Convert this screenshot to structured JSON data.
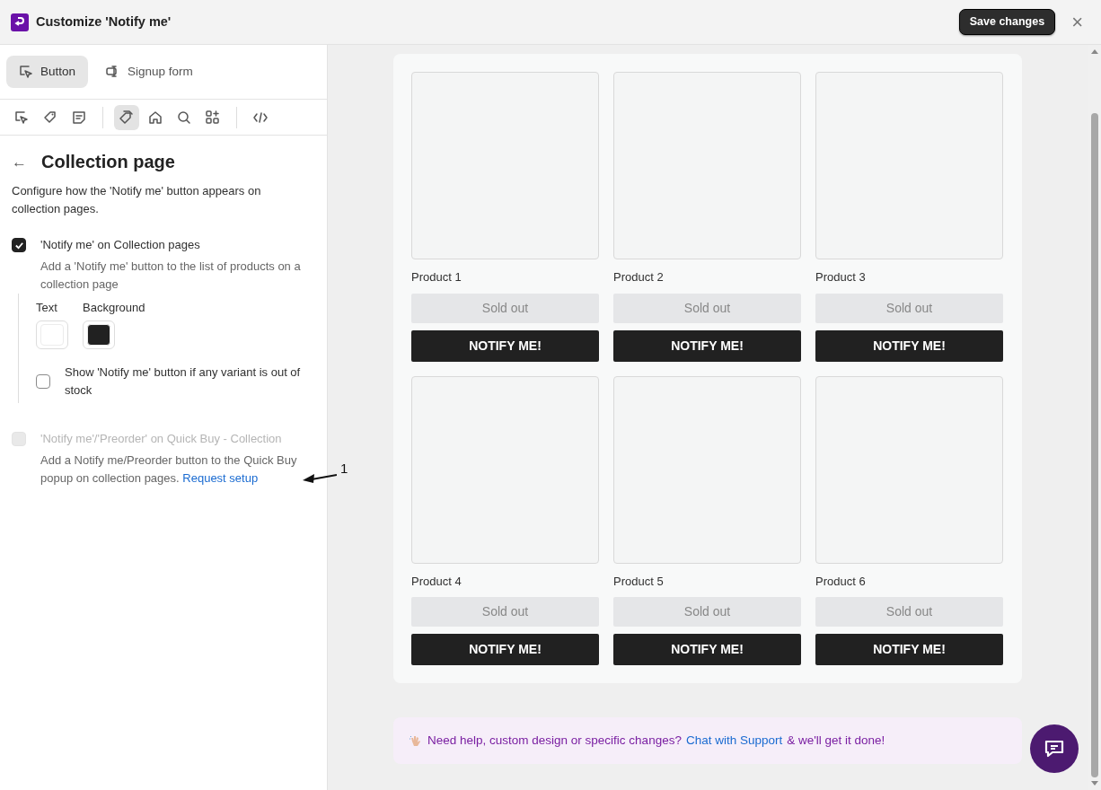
{
  "window": {
    "title": "Customize 'Notify me'",
    "save_button": "Save changes",
    "close": "×"
  },
  "tabs": [
    {
      "label": "Button",
      "kind": "cursor",
      "selected": true
    },
    {
      "label": "Signup form",
      "kind": "form",
      "selected": false
    }
  ],
  "toolbar": [
    [
      {
        "kind": "cursor",
        "selected": false
      },
      {
        "kind": "tag",
        "selected": false
      },
      {
        "kind": "note",
        "selected": false
      }
    ],
    [
      {
        "kind": "tags",
        "selected": true
      },
      {
        "kind": "home",
        "selected": false
      },
      {
        "kind": "search",
        "selected": false
      },
      {
        "kind": "apps",
        "selected": false
      }
    ],
    [
      {
        "kind": "code",
        "selected": false
      }
    ]
  ],
  "section": {
    "back": "←",
    "title": "Collection page",
    "description": "Configure how the 'Notify me' button appears on collection pages."
  },
  "options": [
    {
      "label": "'Notify me' on Collection pages",
      "checked": true,
      "disabled": false,
      "help": "Add a 'Notify me' button to the list of products on a collection page",
      "colors": [
        {
          "label": "Text",
          "color": "#ffffff"
        },
        {
          "label": "Background",
          "color": "#212121"
        }
      ],
      "sub_options": [
        {
          "label": "Show 'Notify me' button if any variant is out of stock",
          "checked": false
        }
      ]
    },
    {
      "label": "'Notify me'/'Preorder' on Quick Buy - Collection",
      "checked": false,
      "disabled": true,
      "help": "Add a Notify me/Preorder button to the Quick Buy popup on collection pages.",
      "link": "Request setup"
    }
  ],
  "annotation": {
    "label": "1"
  },
  "products": [
    {
      "name": "Product 1",
      "status": "Sold out",
      "action": "NOTIFY ME!"
    },
    {
      "name": "Product 2",
      "status": "Sold out",
      "action": "NOTIFY ME!"
    },
    {
      "name": "Product 3",
      "status": "Sold out",
      "action": "NOTIFY ME!"
    },
    {
      "name": "Product 4",
      "status": "Sold out",
      "action": "NOTIFY ME!"
    },
    {
      "name": "Product 5",
      "status": "Sold out",
      "action": "NOTIFY ME!"
    },
    {
      "name": "Product 6",
      "status": "Sold out",
      "action": "NOTIFY ME!"
    }
  ],
  "help_banner": {
    "text": "Need help, custom design or specific changes?",
    "link": "Chat with Support",
    "suffix": "& we'll get it done!"
  }
}
